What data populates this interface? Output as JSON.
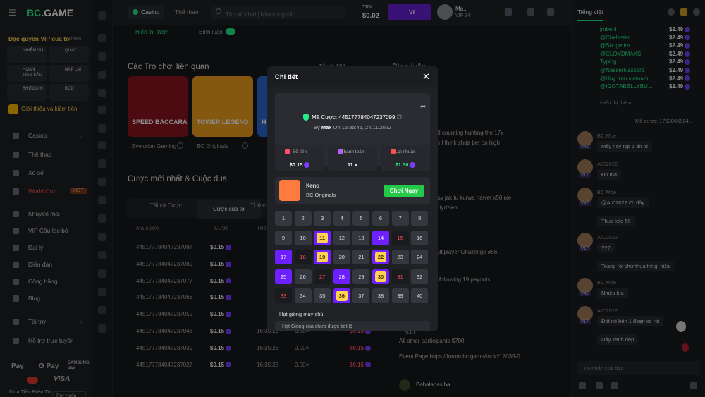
{
  "brand": {
    "name_prefix": "BC",
    "name_suffix": ".GAME"
  },
  "sidebar": {
    "vip_title": "Đặc quyền VIP của tôi",
    "vip_more": "Thêm",
    "vip_tiles": [
      {
        "label": "NHIỆM VỤ",
        "color": "#b25cff"
      },
      {
        "label": "QUAY",
        "color": "#ff5ca8"
      },
      {
        "label": "HOÀN TIỀN SÂU",
        "color": "#ffb800"
      },
      {
        "label": "NẠP LẠI",
        "color": "#24ee89"
      },
      {
        "label": "SHITCOIN",
        "color": "#5cd65c"
      },
      {
        "label": "BCD",
        "color": "#4da3ff"
      }
    ],
    "intro": "Giới thiệu và kiếm tiền",
    "nav": [
      "Casino",
      "Thể thao",
      "Xổ số",
      "World Cup",
      "Khuyến mãi",
      "VIP Câu lạc bộ",
      "Đại lý",
      "Diễn đàn",
      "Công bằng",
      "Blog",
      "Tài trợ",
      "Hỗ trợ trực tuyến"
    ],
    "hot_badge": "HOT",
    "payments": [
      "Pay",
      "G Pay",
      "VISA"
    ],
    "samsung_pay": "SAMSUNG pay",
    "buy_crypto": "Mua Tiền Điện Tử",
    "language": "Thư Ngôn"
  },
  "topbar": {
    "casino": "Casino",
    "sports": "Thể thao",
    "search_placeholder": "Tìm trò chơi | Nhà cung cấp",
    "currency": "TRX",
    "balance": "$0.02",
    "wallet": "Ví",
    "username": "Ma...",
    "vip_level": "VIP 34"
  },
  "main": {
    "show_more": "Hiển thị thêm",
    "comments": "Bình luận",
    "related_games": "Các Trò chơi liên quan",
    "all_label": "Tất cả 198",
    "comments_head": "Bình luận",
    "cards": [
      {
        "label": "Evolution Gaming",
        "title": "SPEED BACCARAT N",
        "color": "#8a1520"
      },
      {
        "label": "BC Originals",
        "title": "TOWER LEGEND",
        "color": "#f0a020"
      },
      {
        "label": "",
        "title": "H",
        "color": "#2a6ad6"
      }
    ],
    "latest_bets": "Cược mới nhất & Cuộc đua",
    "tabs": [
      "Tất cả Cược",
      "Cược của tôi",
      "Tỉ lệ cược cao"
    ],
    "headers": [
      "Mã cược",
      "Cược",
      "Thời gian",
      "Hệ số",
      "Tiền trả"
    ],
    "rows": [
      {
        "id": "445177784047237097",
        "bet": "$0.15",
        "time": "",
        "mult": "",
        "pay": ""
      },
      {
        "id": "445177784047237089",
        "bet": "$0.15",
        "time": "",
        "mult": "",
        "pay": ""
      },
      {
        "id": "445177784047237077",
        "bet": "$0.15",
        "time": "",
        "mult": "",
        "pay": ""
      },
      {
        "id": "445177784047237066",
        "bet": "$0.15",
        "time": "",
        "mult": "",
        "pay": ""
      },
      {
        "id": "445177784047237059",
        "bet": "$0.15",
        "time": "",
        "mult": "",
        "pay": ""
      },
      {
        "id": "445177784047237048",
        "bet": "$0.15",
        "time": "16:35:29",
        "mult": "0.00×",
        "pay": "$0.15"
      },
      {
        "id": "445177784047237039",
        "bet": "$0.15",
        "time": "16:35:26",
        "mult": "0.00×",
        "pay": "$0.15"
      },
      {
        "id": "445177784047237027",
        "bet": "$0.15",
        "time": "16:35:23",
        "mult": "0.00×",
        "pay": "$0.15"
      }
    ]
  },
  "feed": {
    "lines": [
      "...er $50 and still counting hunting the 17x",
      "...didn't hit it atm I think shda bet on high",
      "...adz te konkursy jak tu kurwa nawet x50 nie",
      "...slownie przez tydzien",
      "...stige Keno Multiplayer Challenge #56",
      "...w 13:30 GMT",
      "...v 13:30 GMT",
      "...s many of the following 19 payouts.",
      "....$500",
      "....$300",
      "....$200",
      "....$100",
      "....$50",
      "....$30",
      "All other participants $700",
      "Event Page https://forum.bc.game/topic/12035-0"
    ],
    "footer_user": "Bahalanasiba"
  },
  "chat": {
    "title": "Tiếng việt",
    "wins": [
      {
        "name": "jmbeni",
        "amt": "$2.49"
      },
      {
        "name": "@Chelester",
        "amt": "$2.49"
      },
      {
        "name": "@Sougmire",
        "amt": "$2.49"
      },
      {
        "name": "@CLOYDMAXS",
        "amt": "$2.49"
      },
      {
        "name": "Typing",
        "amt": "$2.49"
      },
      {
        "name": "@NasserNasser1",
        "amt": "$2.49"
      },
      {
        "name": "@Huy tran vietnam",
        "amt": "$2.49"
      },
      {
        "name": "@IGOTABELLYBU...",
        "amt": "$2.49"
      }
    ],
    "show_more": "Hiển thị thêm",
    "bet_ref": "Mã cược: 1753066884...",
    "messages": [
      {
        "user": "BC Moe",
        "lvl": "V42",
        "text": "Mấy nay top 1 ăn tô"
      },
      {
        "user": "AIC2022",
        "lvl": "V17",
        "text": "Đù mã"
      },
      {
        "user": "BC Moe",
        "lvl": "V42",
        "text": "@AIC2022 Ơi đây"
      },
      {
        "user": "",
        "lvl": "",
        "text": "Thua kèo 50"
      },
      {
        "user": "AIC2022",
        "lvl": "V17",
        "text": "???"
      },
      {
        "user": "",
        "lvl": "",
        "text": "Toang rồi chứ thua thì gì nữa"
      },
      {
        "user": "BC Moe",
        "lvl": "V42",
        "text": "Nhiều kìa"
      },
      {
        "user": "AIC2022",
        "lvl": "V17",
        "text": "Đốt nó bền 1 đoạn xo rồi"
      },
      {
        "user": "",
        "lvl": "",
        "text": "Dây xanh đẹp"
      }
    ],
    "input_placeholder": "Tin nhắn của bạn"
  },
  "modal": {
    "title": "Chi tiết",
    "bet_id_label": "Mã Cược:",
    "bet_id": "445177784047237099",
    "by_label": "By",
    "by_user": "Max",
    "on_label": "On",
    "datetime": "16:35:45, 24/11/2022",
    "stats": [
      {
        "label": "Số tiền",
        "value": "$0.15"
      },
      {
        "label": "Thanh toán",
        "value": "11 x"
      },
      {
        "label": "Lợi nhuận",
        "value": "$1.50"
      }
    ],
    "game_name": "Keno",
    "game_provider": "BC Originals",
    "play_button": "Chơi Ngay",
    "grid": [
      [
        "1",
        "n"
      ],
      [
        "2",
        "n"
      ],
      [
        "3",
        "n"
      ],
      [
        "4",
        "n"
      ],
      [
        "5",
        "n"
      ],
      [
        "6",
        "n"
      ],
      [
        "7",
        "n"
      ],
      [
        "8",
        "n"
      ],
      [
        "9",
        "n"
      ],
      [
        "10",
        "n"
      ],
      [
        "11",
        "p"
      ],
      [
        "12",
        "n"
      ],
      [
        "13",
        "n"
      ],
      [
        "14",
        "h"
      ],
      [
        "15",
        "m"
      ],
      [
        "16",
        "n"
      ],
      [
        "17",
        "h"
      ],
      [
        "18",
        "m"
      ],
      [
        "19",
        "p"
      ],
      [
        "20",
        "n"
      ],
      [
        "21",
        "n"
      ],
      [
        "22",
        "p"
      ],
      [
        "23",
        "n"
      ],
      [
        "24",
        "n"
      ],
      [
        "25",
        "h"
      ],
      [
        "26",
        "n"
      ],
      [
        "27",
        "m"
      ],
      [
        "28",
        "h"
      ],
      [
        "29",
        "n"
      ],
      [
        "30",
        "p"
      ],
      [
        "31",
        "m"
      ],
      [
        "32",
        "n"
      ],
      [
        "33",
        "m"
      ],
      [
        "34",
        "n"
      ],
      [
        "35",
        "n"
      ],
      [
        "36",
        "p"
      ],
      [
        "37",
        "n"
      ],
      [
        "38",
        "n"
      ],
      [
        "39",
        "n"
      ],
      [
        "40",
        "n"
      ]
    ],
    "seed_label": "Hạt giống máy chủ",
    "seed_value": "Hạt Giống của chưa được tiết lộ"
  }
}
